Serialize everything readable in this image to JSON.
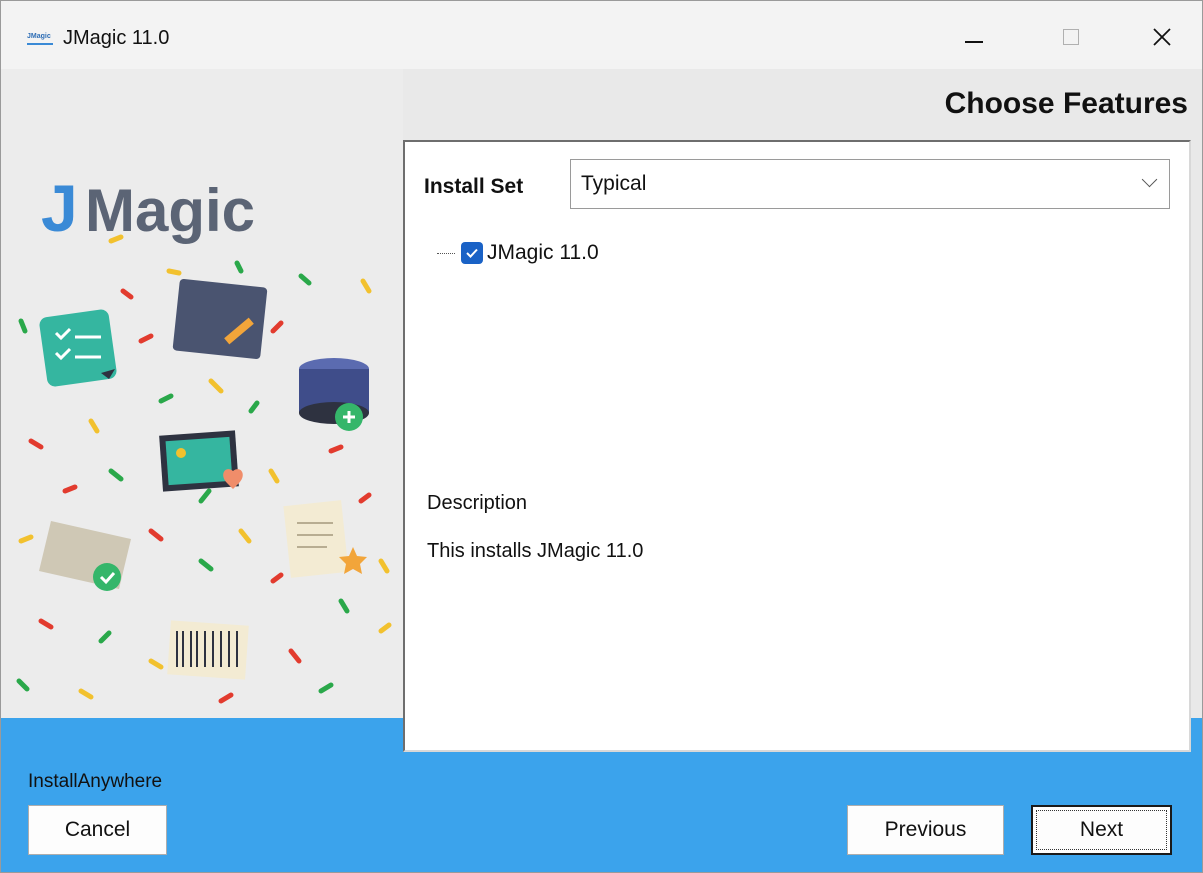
{
  "window": {
    "title": "JMagic 11.0",
    "icon_text": "JMagic"
  },
  "header": {
    "title": "Choose Features"
  },
  "branding": {
    "logo_text": "JMagic",
    "footer_label": "InstallAnywhere"
  },
  "install_set": {
    "label": "Install Set",
    "value": "Typical"
  },
  "features": [
    {
      "label": "JMagic 11.0",
      "checked": true
    }
  ],
  "description": {
    "heading": "Description",
    "text": "This installs JMagic 11.0"
  },
  "buttons": {
    "cancel": "Cancel",
    "previous": "Previous",
    "next": "Next"
  },
  "colors": {
    "accent": "#3ba3ec",
    "logo_blue": "#3a8ad6",
    "logo_grey": "#5b6475",
    "checkbox": "#1a62c6"
  }
}
